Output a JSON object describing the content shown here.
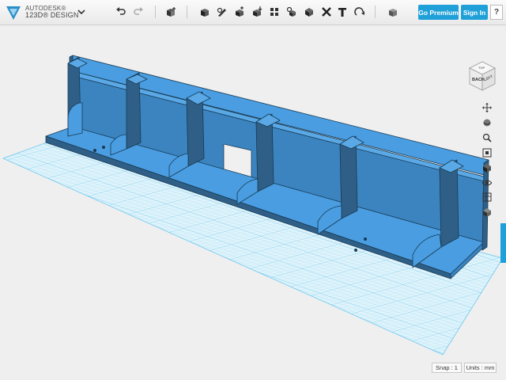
{
  "app": {
    "brand_line1": "AUTODESK®",
    "brand_line2": "123D® DESIGN",
    "logo_icon": "autodesk-triangle-logo",
    "menu_icon": "chevron-down-icon"
  },
  "toolbar": {
    "tools": [
      {
        "name": "undo-icon"
      },
      {
        "name": "redo-icon"
      },
      {
        "name": "transform-icon"
      },
      {
        "name": "primitives-icon"
      },
      {
        "name": "sketch-icon"
      },
      {
        "name": "construct-icon"
      },
      {
        "name": "modify-icon"
      },
      {
        "name": "pattern-icon"
      },
      {
        "name": "grouping-icon"
      },
      {
        "name": "combine-icon"
      },
      {
        "name": "measure-icon"
      },
      {
        "name": "text-icon"
      },
      {
        "name": "snap-icon"
      },
      {
        "name": "material-icon"
      }
    ],
    "go_premium": "Go Premium",
    "sign_in": "Sign In",
    "help": "?"
  },
  "viewcube": {
    "face_front": "BACK",
    "face_side": "LEFT",
    "face_top": "TOP"
  },
  "navbar": {
    "items": [
      "pan-icon",
      "orbit-icon",
      "zoom-icon",
      "fit-icon",
      "view-icon",
      "visibility-icon",
      "materials-icon",
      "grid-icon"
    ]
  },
  "status": {
    "snap": "Snap : 1",
    "units": "Units : mm"
  },
  "colors": {
    "model_face": "#4a9de0",
    "model_dark": "#2f5f86",
    "model_edge": "#173a55",
    "grid": "#7fd0f0",
    "accent": "#1fa0d8"
  }
}
